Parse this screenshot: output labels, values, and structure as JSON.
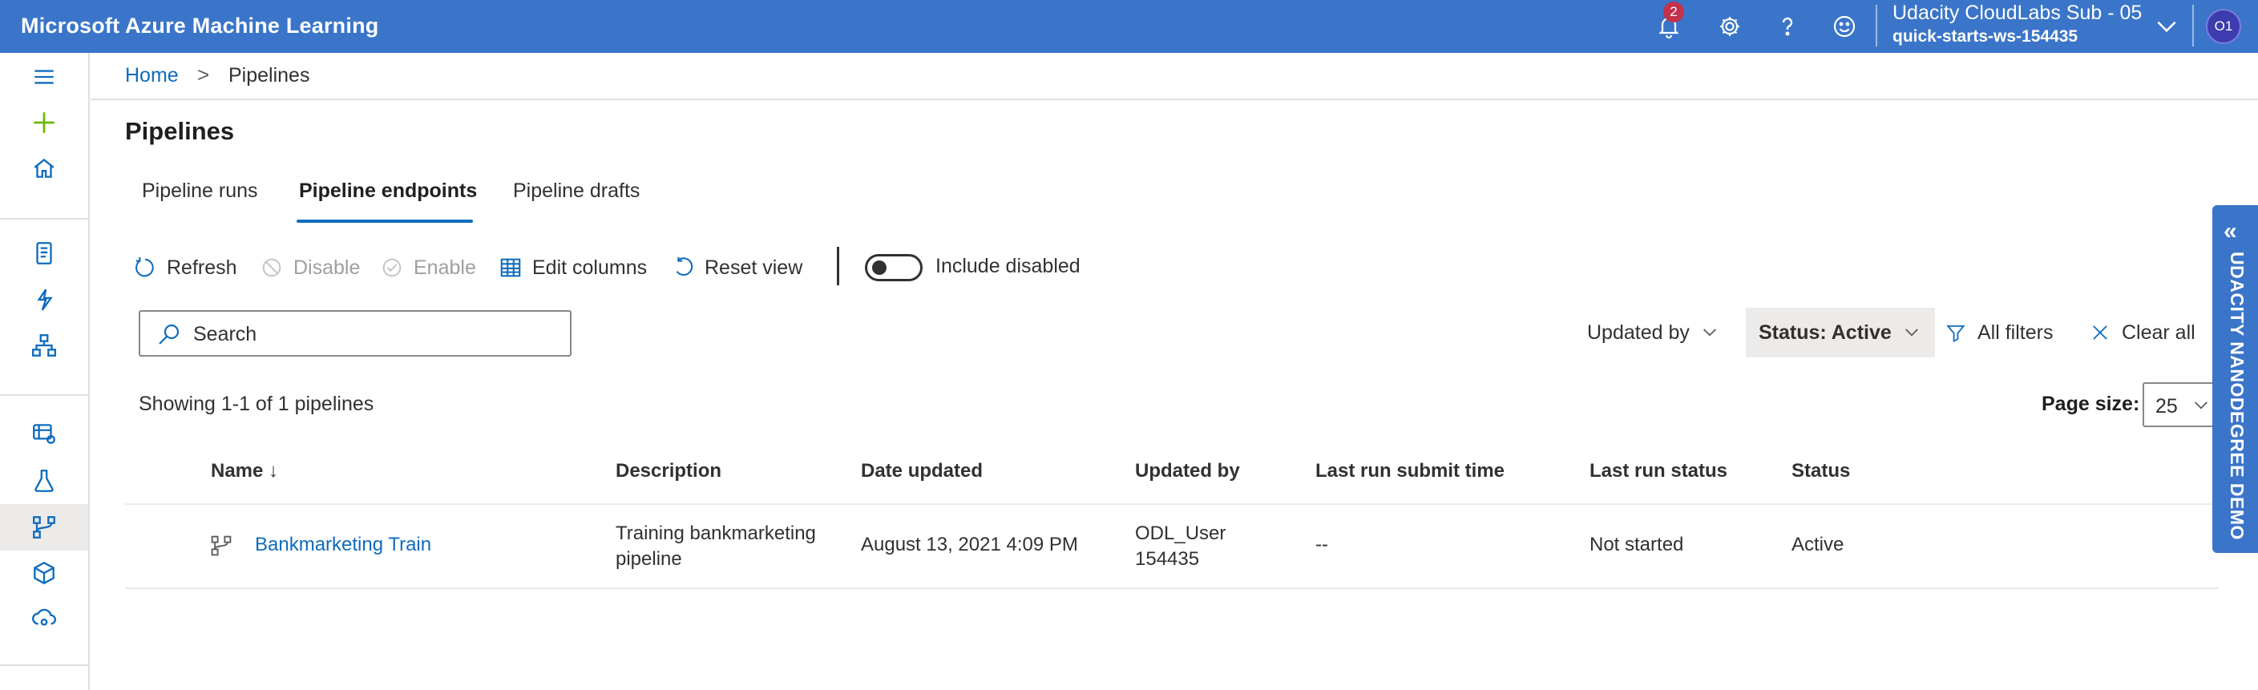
{
  "topbar": {
    "app_title": "Microsoft Azure Machine Learning",
    "notification_count": "2",
    "subscription": "Udacity CloudLabs Sub - 05",
    "workspace": "quick-starts-ws-154435",
    "avatar_initials": "O1",
    "icons": [
      "bell-icon",
      "gear-icon",
      "help-icon",
      "smiley-icon",
      "chevron-down-icon"
    ]
  },
  "leftnav": {
    "items": [
      "menu-icon",
      "plus-icon",
      "home-icon",
      "notebook-icon",
      "automl-icon",
      "designer-icon",
      "datasets-icon",
      "experiments-icon",
      "pipelines-icon",
      "models-icon",
      "endpoints-icon"
    ],
    "selected": "pipelines-icon"
  },
  "breadcrumb": {
    "home": "Home",
    "separator": ">",
    "current": "Pipelines"
  },
  "page": {
    "title": "Pipelines"
  },
  "tabs": [
    {
      "label": "Pipeline runs",
      "active": false
    },
    {
      "label": "Pipeline endpoints",
      "active": true
    },
    {
      "label": "Pipeline drafts",
      "active": false
    }
  ],
  "toolbar": {
    "refresh": "Refresh",
    "disable": "Disable",
    "enable": "Enable",
    "edit_columns": "Edit columns",
    "reset_view": "Reset view",
    "include_disabled": "Include disabled",
    "include_disabled_on": false
  },
  "search": {
    "placeholder": "Search",
    "value": ""
  },
  "filters": {
    "updated_by": "Updated by",
    "status": "Status: Active",
    "all_filters": "All filters",
    "clear_all": "Clear all"
  },
  "list": {
    "showing": "Showing 1-1 of 1 pipelines",
    "page_size_label": "Page size:",
    "page_size": "25"
  },
  "table": {
    "columns": [
      "Name ↓",
      "Description",
      "Date updated",
      "Updated by",
      "Last run submit time",
      "Last run status",
      "Status"
    ],
    "rows": [
      {
        "name": "Bankmarketing Train",
        "description_line1": "Training bankmarketing",
        "description_line2": "pipeline",
        "date_updated": "August 13, 2021 4:09 PM",
        "updated_by_line1": "ODL_User",
        "updated_by_line2": "154435",
        "last_run_submit_time": "--",
        "last_run_status": "Not started",
        "status": "Active"
      }
    ]
  },
  "side_tab": {
    "label": "UDACITY NANODEGREE DEMO"
  },
  "colors": {
    "brand": "#3a75c9",
    "accent": "#0f6cbd",
    "selected_bg": "#edebe9"
  }
}
